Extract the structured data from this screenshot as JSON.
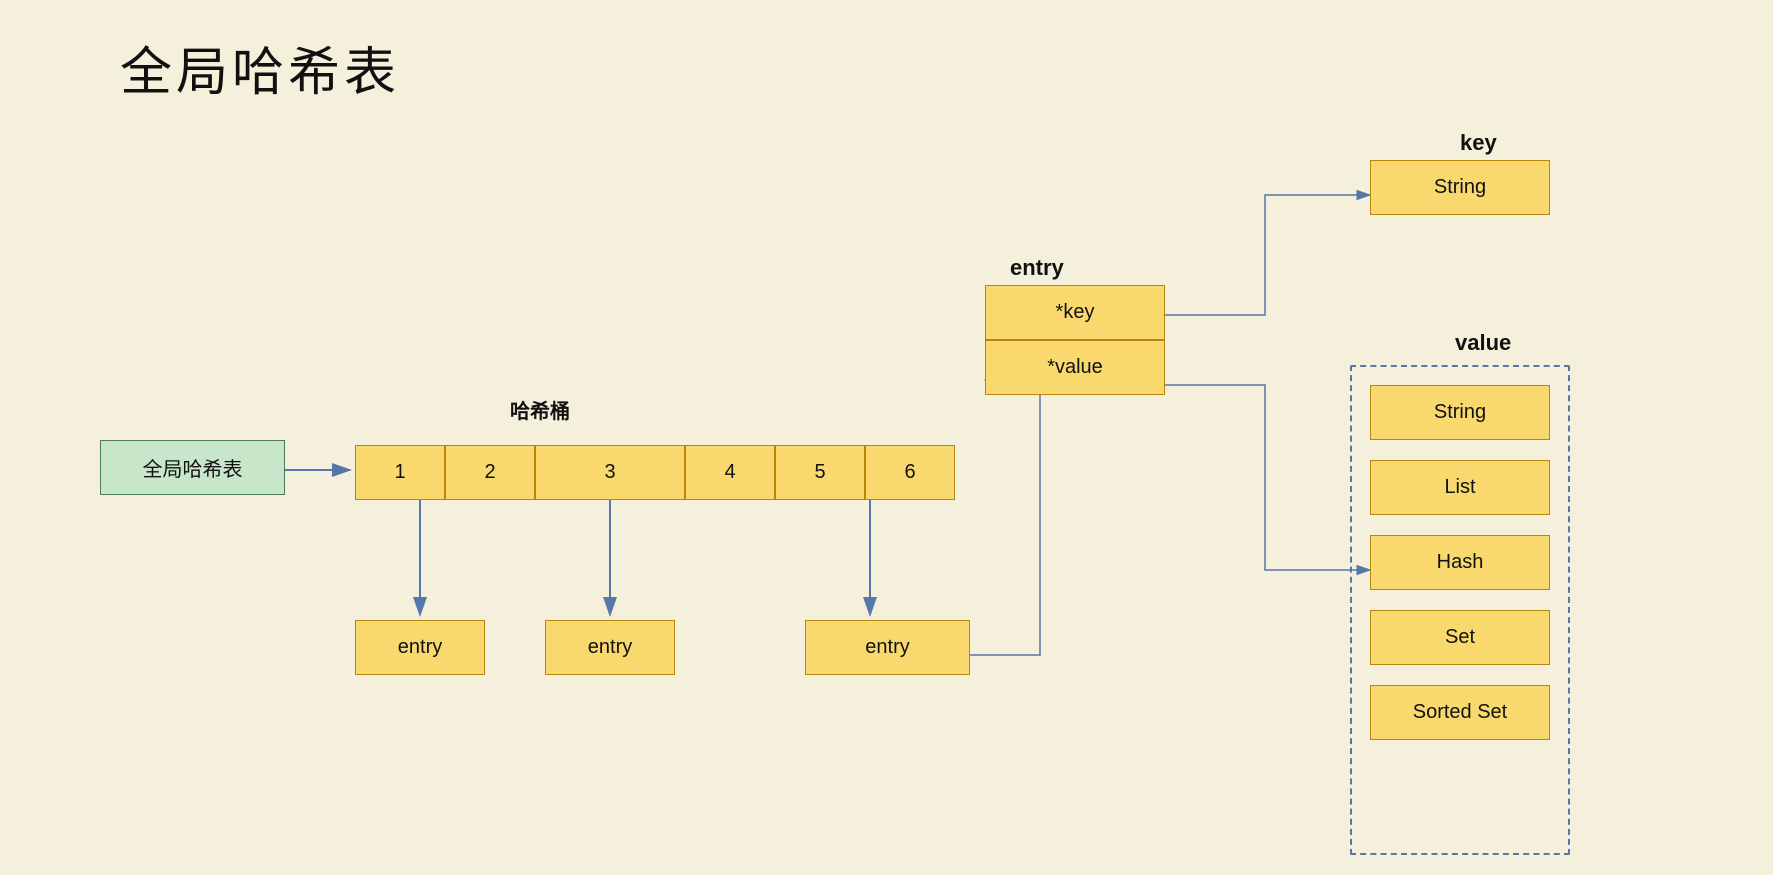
{
  "title": "全局哈希表",
  "global_hashtable_label": "全局哈希表",
  "hash_bucket_label": "哈希桶",
  "entry_label": "entry",
  "key_label": "key",
  "value_label": "value",
  "entry_box": {
    "key_field": "*key",
    "value_field": "*value"
  },
  "bucket_cells": [
    "1",
    "2",
    "3",
    "4",
    "5",
    "6"
  ],
  "value_types": [
    "String",
    "List",
    "Hash",
    "Set",
    "Sorted Set"
  ],
  "key_type": "String",
  "entry_boxes_bottom": [
    "entry",
    "entry",
    "entry"
  ]
}
